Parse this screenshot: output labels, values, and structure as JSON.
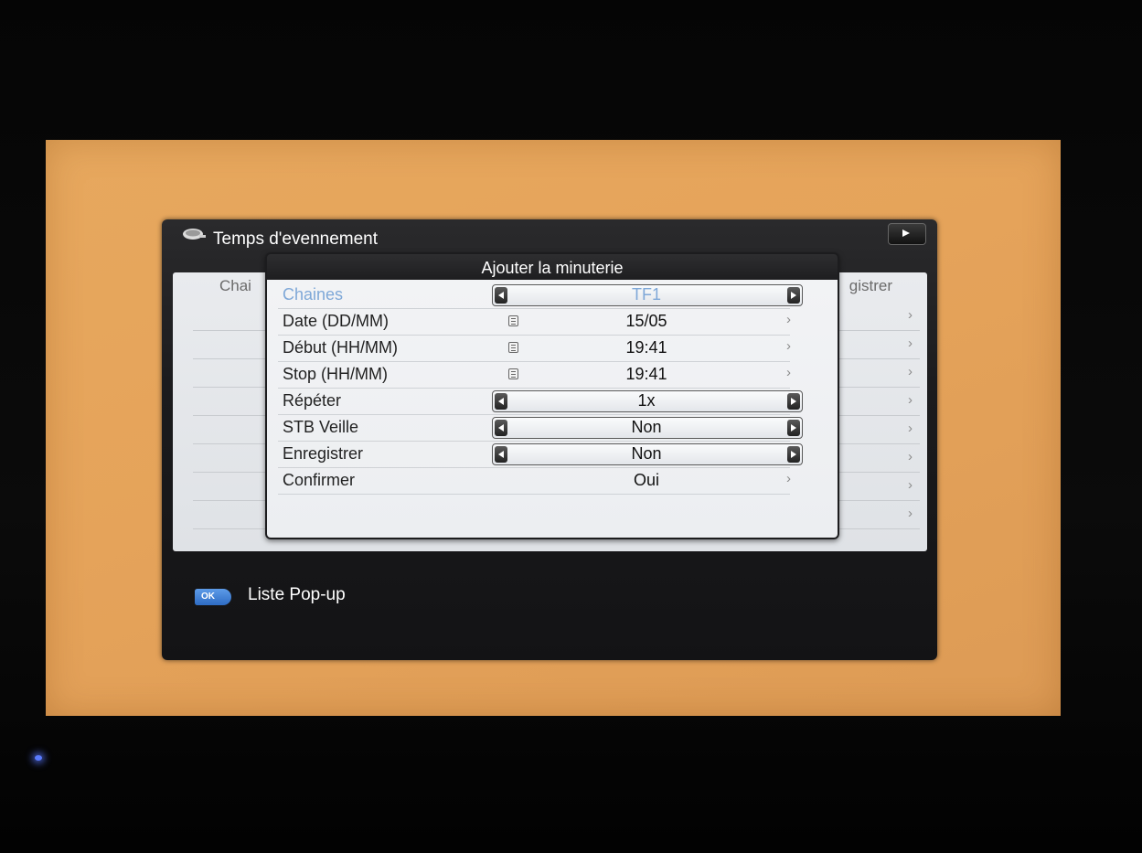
{
  "window": {
    "title": "Temps d'evennement",
    "icon": "satellite-dish-icon",
    "play_icon": "play-icon",
    "list_header_left": "Chai",
    "list_header_right": "gistrer",
    "list_rows": 8
  },
  "dialog": {
    "title": "Ajouter la minuterie",
    "rows": [
      {
        "label": "Chaines",
        "value": "TF1",
        "control": "picker",
        "active": true
      },
      {
        "label": "Date (DD/MM)",
        "value": "15/05",
        "control": "keyboard"
      },
      {
        "label": "Début (HH/MM)",
        "value": "19:41",
        "control": "keyboard"
      },
      {
        "label": "Stop (HH/MM)",
        "value": "19:41",
        "control": "keyboard"
      },
      {
        "label": "Répéter",
        "value": "1x",
        "control": "picker"
      },
      {
        "label": "STB Veille",
        "value": "Non",
        "control": "picker"
      },
      {
        "label": "Enregistrer",
        "value": "Non",
        "control": "picker"
      },
      {
        "label": "Confirmer",
        "value": "Oui",
        "control": "link"
      }
    ]
  },
  "footer": {
    "ok_label": "OK",
    "text": "Liste Pop-up"
  },
  "colors": {
    "screen_bg": "#e5a35a",
    "highlight": "#7fa8d8",
    "ok_badge": "#3a7ad0"
  }
}
